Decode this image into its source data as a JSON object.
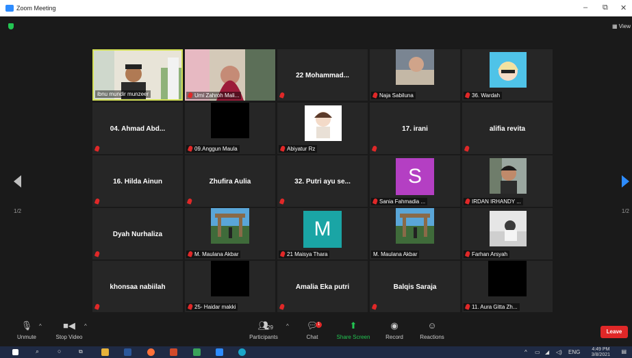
{
  "window": {
    "title": "Zoom Meeting",
    "minimize": "–",
    "restore": "⧉",
    "close": "✕"
  },
  "meeting": {
    "view_label": "View",
    "page_left": "1/2",
    "page_right": "1/2"
  },
  "tiles": [
    {
      "label": "ibnu mundir munzeer",
      "active": true
    },
    {
      "label": "Umi Zahroh Mali..."
    },
    {
      "name": "22 Mohammad..."
    },
    {
      "label": "Naja Sabiluna"
    },
    {
      "label": "36. Wardah"
    },
    {
      "name": "04. Ahmad Abd..."
    },
    {
      "label": "09.Anggun Maula"
    },
    {
      "label": "Abiyatur Rz"
    },
    {
      "name": "17. irani"
    },
    {
      "name": "alifia revita"
    },
    {
      "name": "16. Hilda Ainun"
    },
    {
      "name": "Zhufira Aulia"
    },
    {
      "name": "32. Putri ayu se..."
    },
    {
      "label": "Sania Fahmadia ...",
      "letter": "S",
      "color": "#b43fc3"
    },
    {
      "label": "IRDAN IRHANDY ..."
    },
    {
      "name": "Dyah Nurhaliza"
    },
    {
      "label": "M. Maulana Akbar"
    },
    {
      "label": "21 Maisya Thara",
      "letter": "M",
      "color": "#1aa5a5"
    },
    {
      "label": "M. Maulana Akbar"
    },
    {
      "label": "Farhan Arsyah"
    },
    {
      "name": "khonsaa nabiilah"
    },
    {
      "label": "25- Haidar makki"
    },
    {
      "name": "Amalia Eka putri"
    },
    {
      "name": "Balqis Saraja"
    },
    {
      "label": "11. Aura Gitta Zh..."
    }
  ],
  "toolbar": {
    "unmute": "Unmute",
    "stop_video": "Stop Video",
    "participants": "Participants",
    "participants_count": "29",
    "chat": "Chat",
    "chat_badge": "1",
    "share_screen": "Share Screen",
    "record": "Record",
    "reactions": "Reactions",
    "leave": "Leave"
  },
  "taskbar": {
    "language": "ENG",
    "time": "4:49 PM",
    "date": "3/8/2021"
  },
  "colors": {
    "accent": "#2d8cff",
    "muted_mic": "#e02828",
    "share_green": "#23c552",
    "active_speaker": "#d4e157"
  }
}
